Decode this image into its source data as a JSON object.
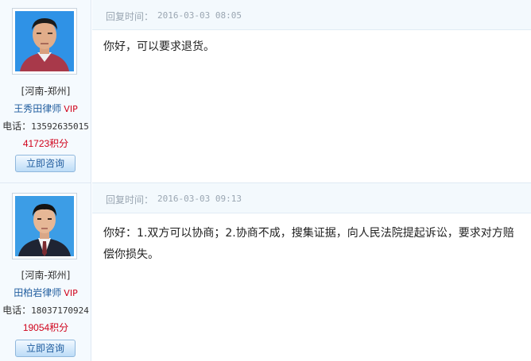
{
  "replies": [
    {
      "lawyer": {
        "region": "[河南-郑州]",
        "name": "王秀田律师",
        "vip": "VIP",
        "phone_label": "电话：",
        "phone": "13592635015",
        "points": "41723积分",
        "consult_label": "立即咨询"
      },
      "time_label": "回复时间：",
      "time": "2016-03-03 08:05",
      "content": "你好，可以要求退货。"
    },
    {
      "lawyer": {
        "region": "[河南-郑州]",
        "name": "田柏岩律师",
        "vip": "VIP",
        "phone_label": "电话：",
        "phone": "18037170924",
        "points": "19054积分",
        "consult_label": "立即咨询"
      },
      "time_label": "回复时间：",
      "time": "2016-03-03 09:13",
      "content": "你好：1.双方可以协商；2.协商不成，搜集证据，向人民法院提起诉讼，要求对方赔偿你损失。"
    }
  ]
}
